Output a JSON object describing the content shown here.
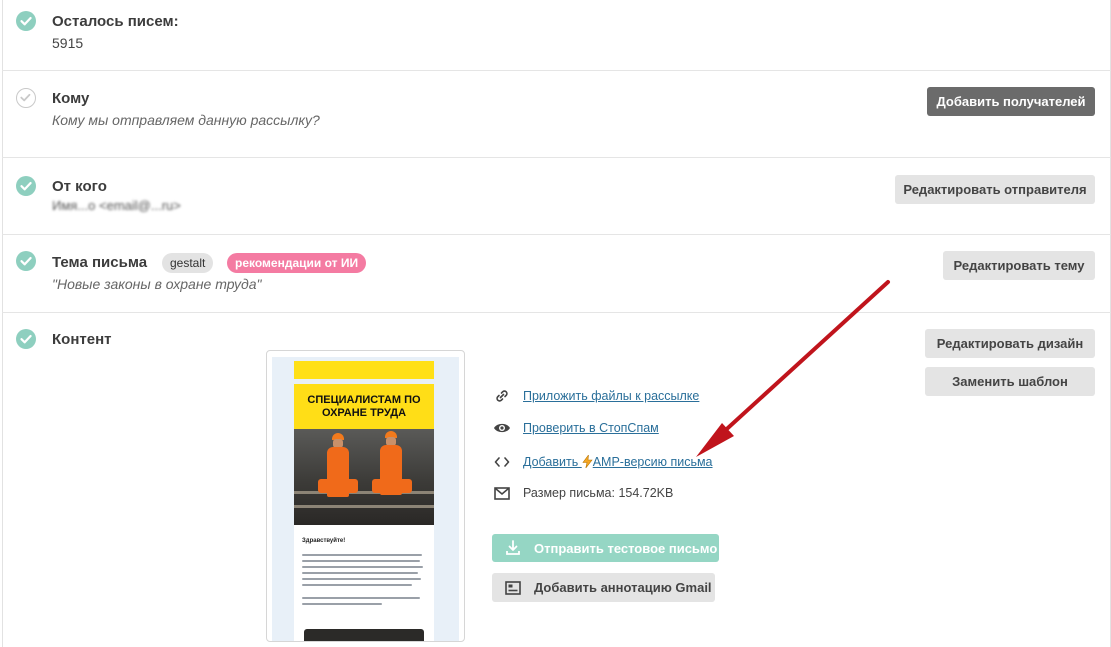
{
  "sections": {
    "remaining": {
      "title": "Осталось писем:",
      "value": "5915"
    },
    "to": {
      "title": "Кому",
      "subtitle": "Кому мы отправляем данную рассылку?",
      "button": "Добавить получателей"
    },
    "from": {
      "title": "От кого",
      "value": "Имя...о <email@...ru>",
      "button": "Редактировать отправителя"
    },
    "subject": {
      "title": "Тема письма",
      "tag_gestalt": "gestalt",
      "tag_ai": "рекомендации от ИИ",
      "value": "\"Новые законы в охране труда\"",
      "button": "Редактировать тему"
    },
    "content": {
      "title": "Контент",
      "button_design": "Редактировать дизайн",
      "button_template": "Заменить шаблон",
      "preview": {
        "headline": "СПЕЦИАЛИСТАМ ПО ОХРАНЕ ТРУДА",
        "greeting": "Здравствуйте!"
      },
      "links": {
        "attach": "Приложить файлы к рассылке",
        "spam": "Проверить в СтопСпам",
        "amp_prefix": "Добавить ",
        "amp_suffix": "AMP-версию письма",
        "size": "Размер письма: 154.72KB"
      },
      "send_test": "Отправить тестовое письмо",
      "gmail": "Добавить аннотацию Gmail"
    }
  },
  "colors": {
    "check": "#8ecfbf",
    "link": "#2a6f9a",
    "ai_tag": "#f47ba2",
    "arrow": "#c0141c",
    "send_test": "#95d6c4"
  },
  "icons": [
    "check-icon",
    "link-icon",
    "eye-icon",
    "code-icon",
    "lightning-icon",
    "envelope-icon",
    "download-icon",
    "annotation-icon"
  ]
}
